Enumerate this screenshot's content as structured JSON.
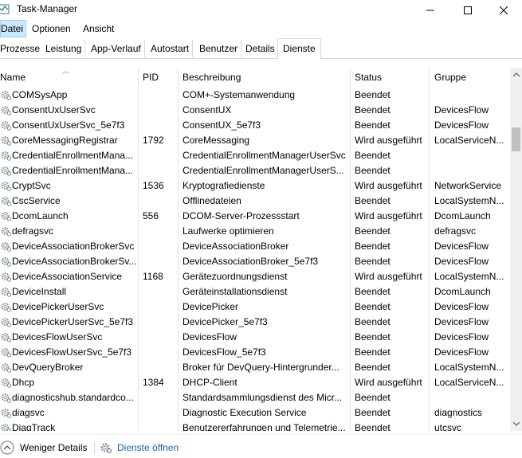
{
  "window": {
    "title": "Task-Manager"
  },
  "menu": {
    "items": [
      "Datei",
      "Optionen",
      "Ansicht"
    ]
  },
  "tabs": [
    "Prozesse",
    "Leistung",
    "App-Verlauf",
    "Autostart",
    "Benutzer",
    "Details",
    "Dienste"
  ],
  "active_tab": "Dienste",
  "columns": [
    "Name",
    "PID",
    "Beschreibung",
    "Status",
    "Gruppe"
  ],
  "services": [
    {
      "name": "COMSysApp",
      "pid": "",
      "desc": "COM+-Systemanwendung",
      "status": "Beendet",
      "group": ""
    },
    {
      "name": "ConsentUxUserSvc",
      "pid": "",
      "desc": "ConsentUX",
      "status": "Beendet",
      "group": "DevicesFlow"
    },
    {
      "name": "ConsentUxUserSvc_5e7f3",
      "pid": "",
      "desc": "ConsentUX_5e7f3",
      "status": "Beendet",
      "group": "DevicesFlow"
    },
    {
      "name": "CoreMessagingRegistrar",
      "pid": "1792",
      "desc": "CoreMessaging",
      "status": "Wird ausgeführt",
      "group": "LocalServiceN..."
    },
    {
      "name": "CredentialEnrollmentMana...",
      "pid": "",
      "desc": "CredentialEnrollmentManagerUserSvc",
      "status": "Beendet",
      "group": ""
    },
    {
      "name": "CredentialEnrollmentMana...",
      "pid": "",
      "desc": "CredentialEnrollmentManagerUserS...",
      "status": "Beendet",
      "group": ""
    },
    {
      "name": "CryptSvc",
      "pid": "1536",
      "desc": "Kryptografiedienste",
      "status": "Wird ausgeführt",
      "group": "NetworkService"
    },
    {
      "name": "CscService",
      "pid": "",
      "desc": "Offlinedateien",
      "status": "Beendet",
      "group": "LocalSystemN..."
    },
    {
      "name": "DcomLaunch",
      "pid": "556",
      "desc": "DCOM-Server-Prozessstart",
      "status": "Wird ausgeführt",
      "group": "DcomLaunch"
    },
    {
      "name": "defragsvc",
      "pid": "",
      "desc": "Laufwerke optimieren",
      "status": "Beendet",
      "group": "defragsvc"
    },
    {
      "name": "DeviceAssociationBrokerSvc",
      "pid": "",
      "desc": "DeviceAssociationBroker",
      "status": "Beendet",
      "group": "DevicesFlow"
    },
    {
      "name": "DeviceAssociationBrokerSv...",
      "pid": "",
      "desc": "DeviceAssociationBroker_5e7f3",
      "status": "Beendet",
      "group": "DevicesFlow"
    },
    {
      "name": "DeviceAssociationService",
      "pid": "1168",
      "desc": "Gerätezuordnungsdienst",
      "status": "Wird ausgeführt",
      "group": "LocalSystemN..."
    },
    {
      "name": "DeviceInstall",
      "pid": "",
      "desc": "Geräteinstallationsdienst",
      "status": "Beendet",
      "group": "DcomLaunch"
    },
    {
      "name": "DevicePickerUserSvc",
      "pid": "",
      "desc": "DevicePicker",
      "status": "Beendet",
      "group": "DevicesFlow"
    },
    {
      "name": "DevicePickerUserSvc_5e7f3",
      "pid": "",
      "desc": "DevicePicker_5e7f3",
      "status": "Beendet",
      "group": "DevicesFlow"
    },
    {
      "name": "DevicesFlowUserSvc",
      "pid": "",
      "desc": "DevicesFlow",
      "status": "Beendet",
      "group": "DevicesFlow"
    },
    {
      "name": "DevicesFlowUserSvc_5e7f3",
      "pid": "",
      "desc": "DevicesFlow_5e7f3",
      "status": "Beendet",
      "group": "DevicesFlow"
    },
    {
      "name": "DevQueryBroker",
      "pid": "",
      "desc": "Broker für DevQuery-Hintergrunder...",
      "status": "Beendet",
      "group": "LocalSystemN..."
    },
    {
      "name": "Dhcp",
      "pid": "1384",
      "desc": "DHCP-Client",
      "status": "Wird ausgeführt",
      "group": "LocalServiceN..."
    },
    {
      "name": "diagnosticshub.standardco...",
      "pid": "",
      "desc": "Standardsammlungsdienst des Micr...",
      "status": "Beendet",
      "group": ""
    },
    {
      "name": "diagsvc",
      "pid": "",
      "desc": "Diagnostic Execution Service",
      "status": "Beendet",
      "group": "diagnostics"
    },
    {
      "name": "DiagTrack",
      "pid": "",
      "desc": "Benutzererfahrungen und Telemetrie...",
      "status": "Beendet",
      "group": "utcsvc"
    }
  ],
  "footer": {
    "fewer_details": "Weniger Details",
    "open_services": "Dienste öffnen"
  },
  "colors": {
    "menu_active_bg": "#cce8ff",
    "link": "#1a5fb4"
  }
}
